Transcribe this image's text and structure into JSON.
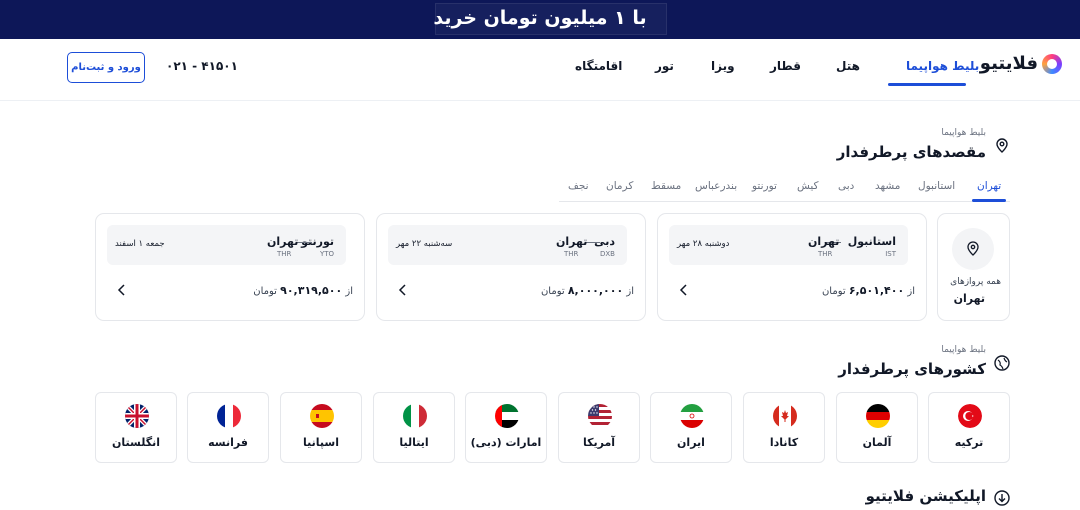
{
  "banner": {
    "text": "با ۱ میلیون تومان خرید"
  },
  "header": {
    "logo": "فلایتیو",
    "nav": [
      "بلیط هواپیما",
      "هتل",
      "قطار",
      "ویزا",
      "تور",
      "اقامتگاه"
    ],
    "phone": "۰۲۱ - ۴۱۵۰۱",
    "login": "ورود و ثبت‌نام"
  },
  "popular_destinations": {
    "subtitle": "بلیط هواپیما",
    "title": "مقصدهای پرطرفدار",
    "tabs": [
      "تهران",
      "استانبول",
      "مشهد",
      "دبی",
      "کیش",
      "تورنتو",
      "بندرعباس",
      "مسقط",
      "کرمان",
      "نجف"
    ],
    "all_flights_label": "همه پروازهای",
    "all_flights_city": "تهران",
    "flights": [
      {
        "from": "تهران",
        "from_code": "THR",
        "to": "استانبول",
        "to_code": "IST",
        "date": "دوشنبه ۲۸ مهر",
        "price_prefix": "از",
        "price": "۶,۵۰۱,۴۰۰",
        "currency": "تومان"
      },
      {
        "from": "تهران",
        "from_code": "THR",
        "to": "دبی",
        "to_code": "DXB",
        "date": "سه‌شنبه ۲۲ مهر",
        "price_prefix": "از",
        "price": "۸,۰۰۰,۰۰۰",
        "currency": "تومان"
      },
      {
        "from": "تهران",
        "from_code": "THR",
        "to": "تورنتو",
        "to_code": "YTO",
        "date": "جمعه ۱ اسفند",
        "price_prefix": "از",
        "price": "۹۰,۳۱۹,۵۰۰",
        "currency": "تومان"
      }
    ]
  },
  "popular_countries": {
    "subtitle": "بلیط هواپیما",
    "title": "کشورهای پرطرفدار",
    "countries": [
      "ترکیه",
      "آلمان",
      "کانادا",
      "ایران",
      "آمریکا",
      "امارات (دبی)",
      "ایتالیا",
      "اسپانیا",
      "فرانسه",
      "انگلستان"
    ]
  },
  "app_section": {
    "title": "اپلیکیشن فلایتیو"
  },
  "colors": {
    "banner": "#0d1758",
    "accent": "#1d4ed8",
    "border": "#e5e7eb"
  }
}
